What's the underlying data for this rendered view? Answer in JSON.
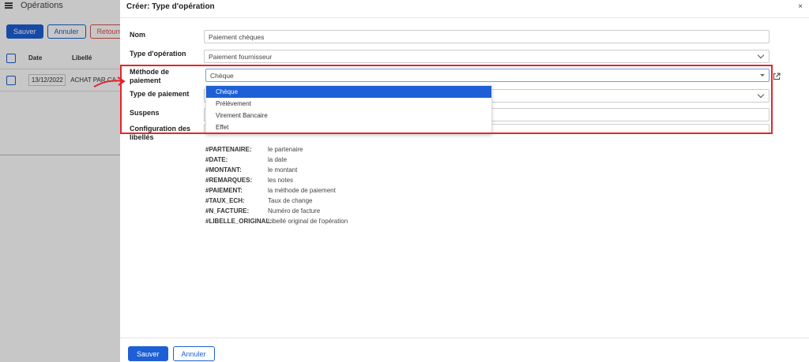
{
  "background": {
    "title": "Opérations",
    "buttons": {
      "save": "Sauver",
      "cancel": "Annuler",
      "back": "Retourner"
    },
    "table": {
      "headers": {
        "date": "Date",
        "label": "Libellé"
      },
      "rows": [
        {
          "date": "13/12/2022",
          "label": "ACHAT PAR CA"
        }
      ]
    }
  },
  "modal": {
    "title": "Créer: Type d'opération",
    "close": "×",
    "fields": {
      "nom": {
        "label": "Nom",
        "value": "Paiement chèques"
      },
      "type_operation": {
        "label": "Type d'opération",
        "value": "Paiement fournisseur"
      },
      "methode_paiement": {
        "label": "Méthode de paiement",
        "value": "Chèque"
      },
      "type_paiement": {
        "label": "Type de paiement",
        "value": ""
      },
      "suspens": {
        "label": "Suspens",
        "value": ""
      },
      "config_libelles": {
        "label": "Configuration des libellés",
        "value": ""
      }
    },
    "dropdown_options": [
      "Chèque",
      "Prélèvement",
      "Virement Bancaire",
      "Effet"
    ],
    "dropdown_selected": "Chèque",
    "variables": [
      {
        "key": "#PARTENAIRE:",
        "desc": "le partenaire"
      },
      {
        "key": "#DATE:",
        "desc": "la date"
      },
      {
        "key": "#MONTANT:",
        "desc": "le montant"
      },
      {
        "key": "#REMARQUES:",
        "desc": "les notes"
      },
      {
        "key": "#PAIEMENT:",
        "desc": "la méthode de paiement"
      },
      {
        "key": "#TAUX_ECH:",
        "desc": "Taux de change"
      },
      {
        "key": "#N_FACTURE:",
        "desc": "Numéro de facture"
      },
      {
        "key": "#LIBELLE_ORIGINAL:",
        "desc": "Libellé original de l'opération"
      }
    ],
    "footer": {
      "save": "Sauver",
      "cancel": "Annuler"
    }
  },
  "colors": {
    "primary": "#1d5fd6",
    "highlight": "#e3262d",
    "danger": "#d9534f"
  },
  "icons": {
    "external_link": "external-link-icon",
    "menu": "hamburger-icon",
    "arrow": "curved-arrow-icon"
  }
}
